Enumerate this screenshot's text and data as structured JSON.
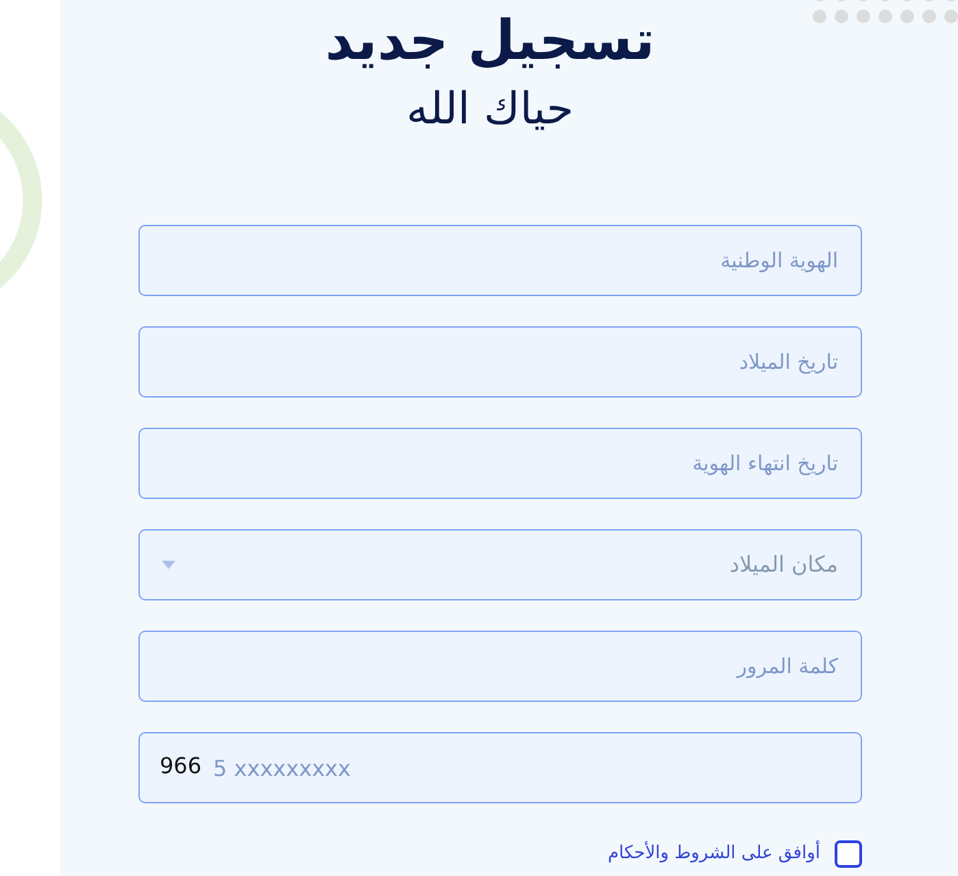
{
  "title": "تسجيل جديد",
  "subtitle": "حياك الله",
  "fields": [
    {
      "kind": "text",
      "placeholder": "الهوية الوطنية"
    },
    {
      "kind": "text",
      "placeholder": "تاريخ الميلاد"
    },
    {
      "kind": "text",
      "placeholder": "تاريخ انتهاء الهوية"
    },
    {
      "kind": "select",
      "placeholder": "مكان الميلاد"
    },
    {
      "kind": "text",
      "placeholder": "كلمة المرور"
    },
    {
      "kind": "phone",
      "prefix": "966",
      "placeholder": "5 xxxxxxxxx"
    }
  ],
  "terms": {
    "label": "أوافق على الشروط والأحكام",
    "checked": false
  }
}
